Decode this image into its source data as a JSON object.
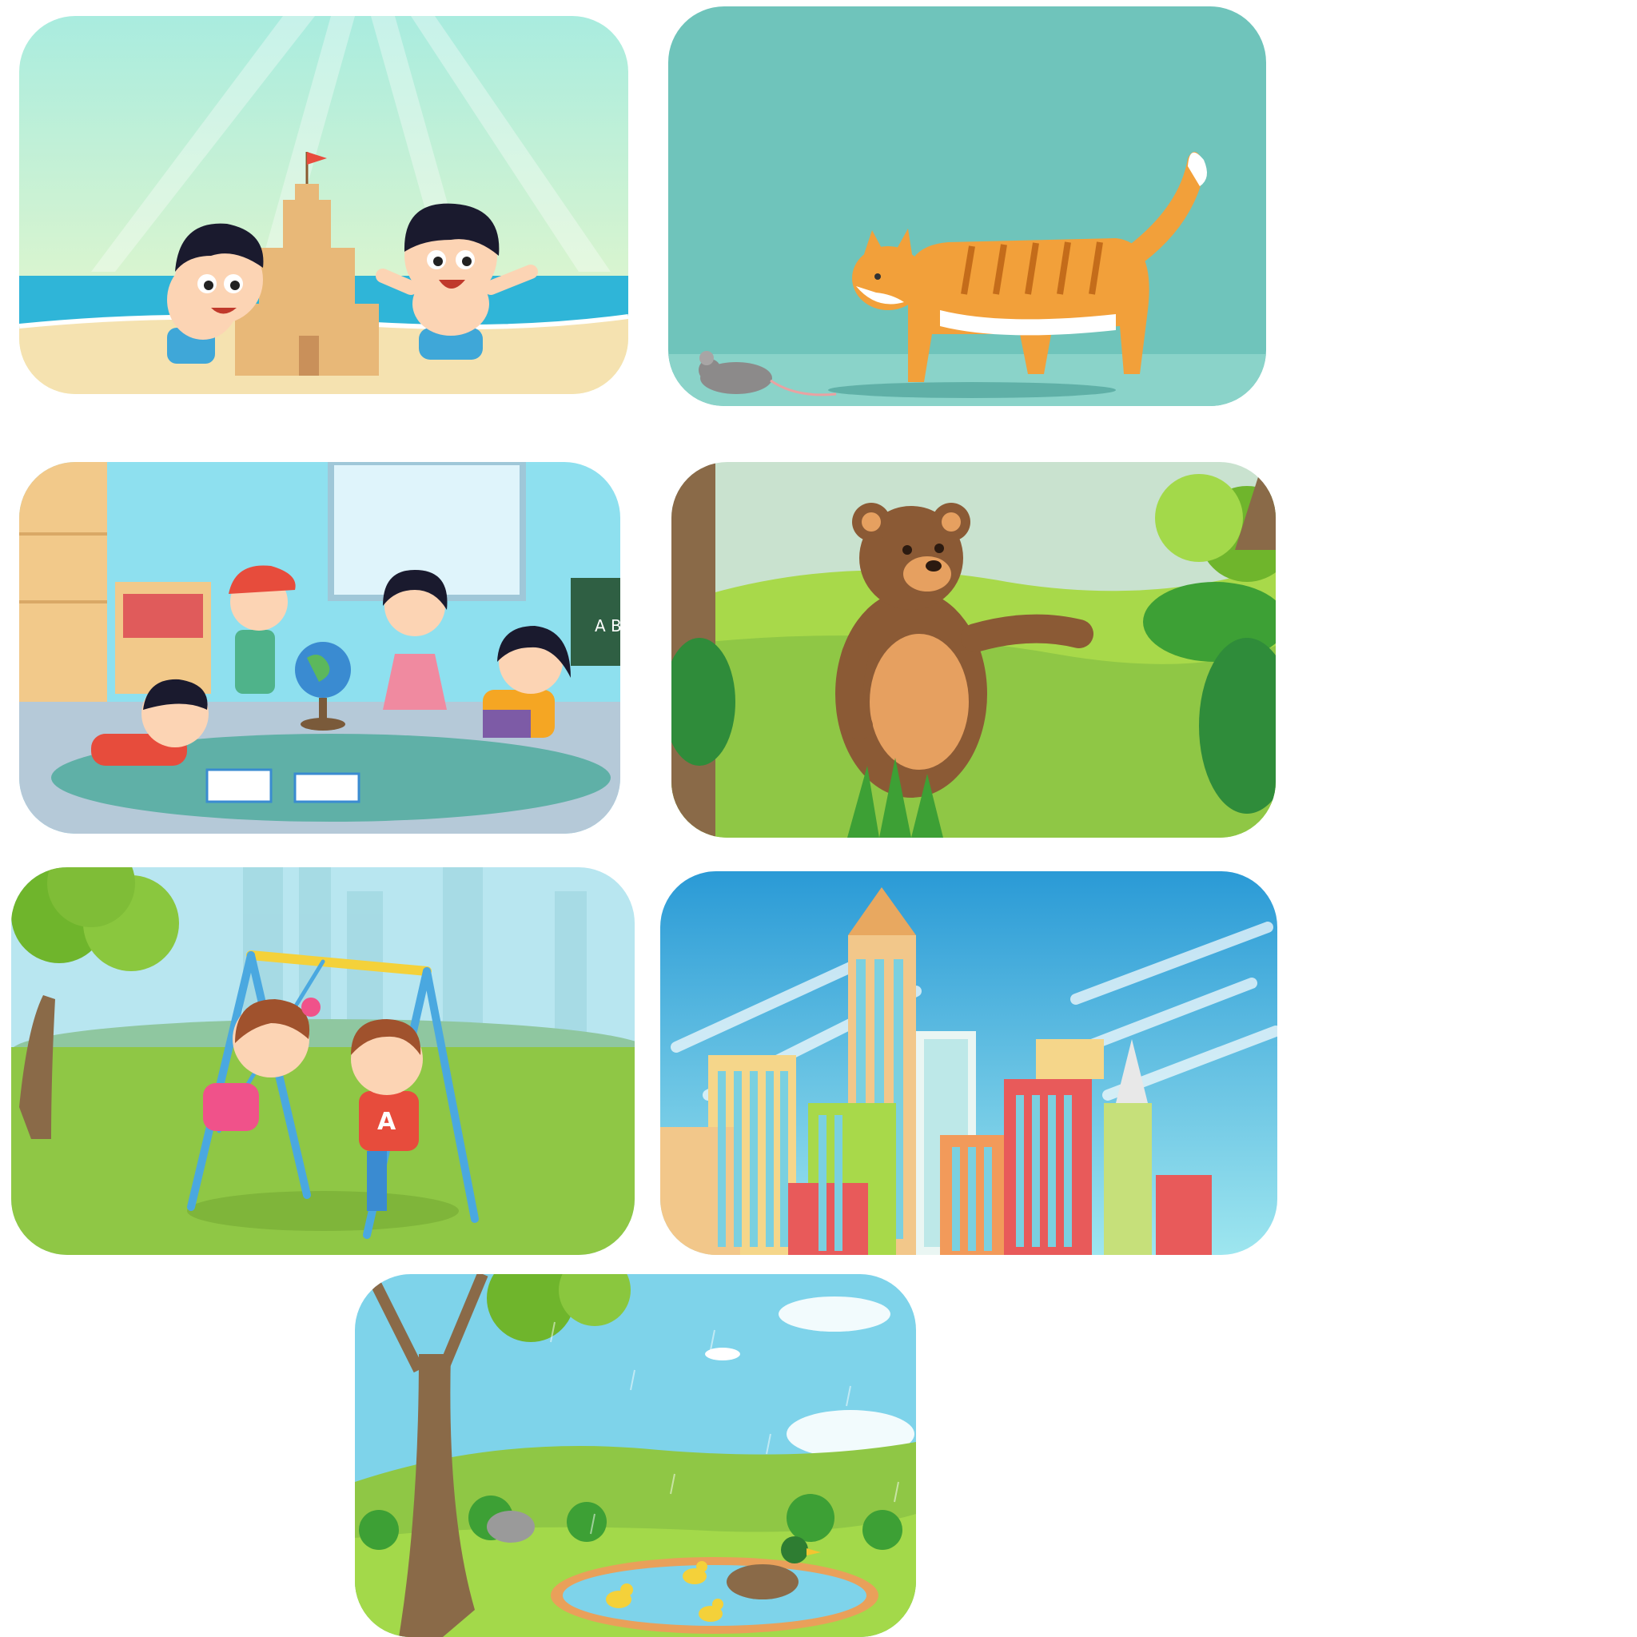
{
  "cards": [
    {
      "id": "beach",
      "scene": "children-building-sandcastle-on-beach"
    },
    {
      "id": "cat",
      "scene": "cat-walking-toward-mouse"
    },
    {
      "id": "class",
      "scene": "children-reading-in-classroom"
    },
    {
      "id": "bear",
      "scene": "bear-in-forest-meadow"
    },
    {
      "id": "swing",
      "scene": "children-on-swing-in-park"
    },
    {
      "id": "city",
      "scene": "city-skyscrapers"
    },
    {
      "id": "rain",
      "scene": "rainy-park-with-duck-pond"
    }
  ],
  "classroom": {
    "chalkboard_text": "A B"
  },
  "swing_scene": {
    "shirt_letter": "A"
  },
  "colors": {
    "beach_sky": "#c8f2e2",
    "sea": "#2fb5d8",
    "sand": "#f5e2b0",
    "cat_bg": "#6fc4bb",
    "cat_orange": "#f2a03a",
    "grass": "#8fc745",
    "sky_blue": "#7ed3ea",
    "city_sky": "#2a9ad6"
  }
}
